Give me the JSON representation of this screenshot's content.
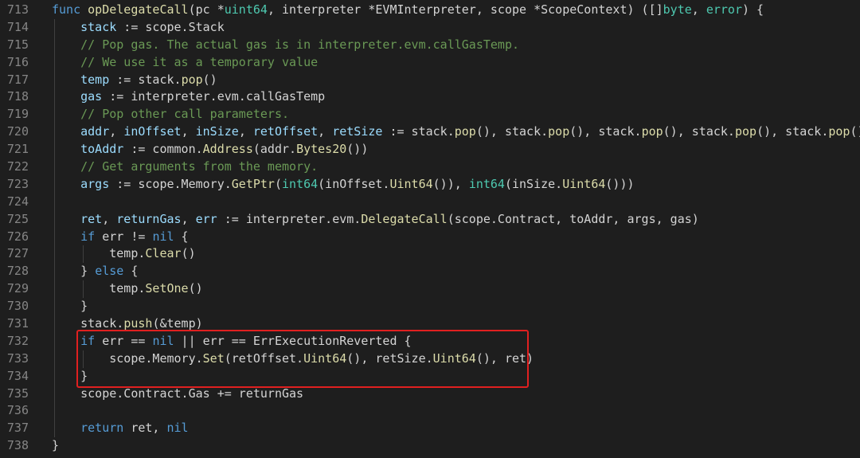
{
  "editor": {
    "lines": [
      {
        "n": "713",
        "indent": 0,
        "tokens": [
          [
            "kw",
            "func "
          ],
          [
            "fn",
            "opDelegateCall"
          ],
          [
            "pl",
            "(pc *"
          ],
          [
            "ty",
            "uint64"
          ],
          [
            "pl",
            ", interpreter *EVMInterpreter, scope *ScopeContext) ([]"
          ],
          [
            "ty",
            "byte"
          ],
          [
            "pl",
            ", "
          ],
          [
            "ty",
            "error"
          ],
          [
            "pl",
            ") {"
          ]
        ]
      },
      {
        "n": "714",
        "indent": 1,
        "tokens": [
          [
            "vr",
            "stack"
          ],
          [
            "pl",
            " := scope.Stack"
          ]
        ]
      },
      {
        "n": "715",
        "indent": 1,
        "tokens": [
          [
            "cm",
            "// Pop gas. The actual gas is in interpreter.evm.callGasTemp."
          ]
        ]
      },
      {
        "n": "716",
        "indent": 1,
        "tokens": [
          [
            "cm",
            "// We use it as a temporary value"
          ]
        ]
      },
      {
        "n": "717",
        "indent": 1,
        "tokens": [
          [
            "vr",
            "temp"
          ],
          [
            "pl",
            " := stack."
          ],
          [
            "fn",
            "pop"
          ],
          [
            "pl",
            "()"
          ]
        ]
      },
      {
        "n": "718",
        "indent": 1,
        "tokens": [
          [
            "vr",
            "gas"
          ],
          [
            "pl",
            " := interpreter.evm.callGasTemp"
          ]
        ]
      },
      {
        "n": "719",
        "indent": 1,
        "tokens": [
          [
            "cm",
            "// Pop other call parameters."
          ]
        ]
      },
      {
        "n": "720",
        "indent": 1,
        "tokens": [
          [
            "vr",
            "addr"
          ],
          [
            "pl",
            ", "
          ],
          [
            "vr",
            "inOffset"
          ],
          [
            "pl",
            ", "
          ],
          [
            "vr",
            "inSize"
          ],
          [
            "pl",
            ", "
          ],
          [
            "vr",
            "retOffset"
          ],
          [
            "pl",
            ", "
          ],
          [
            "vr",
            "retSize"
          ],
          [
            "pl",
            " := stack."
          ],
          [
            "fn",
            "pop"
          ],
          [
            "pl",
            "(), stack."
          ],
          [
            "fn",
            "pop"
          ],
          [
            "pl",
            "(), stack."
          ],
          [
            "fn",
            "pop"
          ],
          [
            "pl",
            "(), stack."
          ],
          [
            "fn",
            "pop"
          ],
          [
            "pl",
            "(), stack."
          ],
          [
            "fn",
            "pop"
          ],
          [
            "pl",
            "()"
          ]
        ]
      },
      {
        "n": "721",
        "indent": 1,
        "tokens": [
          [
            "vr",
            "toAddr"
          ],
          [
            "pl",
            " := common."
          ],
          [
            "fn",
            "Address"
          ],
          [
            "pl",
            "(addr."
          ],
          [
            "fn",
            "Bytes20"
          ],
          [
            "pl",
            "())"
          ]
        ]
      },
      {
        "n": "722",
        "indent": 1,
        "tokens": [
          [
            "cm",
            "// Get arguments from the memory."
          ]
        ]
      },
      {
        "n": "723",
        "indent": 1,
        "tokens": [
          [
            "vr",
            "args"
          ],
          [
            "pl",
            " := scope.Memory."
          ],
          [
            "fn",
            "GetPtr"
          ],
          [
            "pl",
            "("
          ],
          [
            "ty",
            "int64"
          ],
          [
            "pl",
            "(inOffset."
          ],
          [
            "fn",
            "Uint64"
          ],
          [
            "pl",
            "()), "
          ],
          [
            "ty",
            "int64"
          ],
          [
            "pl",
            "(inSize."
          ],
          [
            "fn",
            "Uint64"
          ],
          [
            "pl",
            "()))"
          ]
        ]
      },
      {
        "n": "724",
        "indent": 1,
        "tokens": []
      },
      {
        "n": "725",
        "indent": 1,
        "tokens": [
          [
            "vr",
            "ret"
          ],
          [
            "pl",
            ", "
          ],
          [
            "vr",
            "returnGas"
          ],
          [
            "pl",
            ", "
          ],
          [
            "vr",
            "err"
          ],
          [
            "pl",
            " := interpreter.evm."
          ],
          [
            "fn",
            "DelegateCall"
          ],
          [
            "pl",
            "(scope.Contract, toAddr, args, gas)"
          ]
        ]
      },
      {
        "n": "726",
        "indent": 1,
        "tokens": [
          [
            "kw",
            "if"
          ],
          [
            "pl",
            " err != "
          ],
          [
            "kw",
            "nil"
          ],
          [
            "pl",
            " {"
          ]
        ]
      },
      {
        "n": "727",
        "indent": 2,
        "tokens": [
          [
            "pl",
            "temp."
          ],
          [
            "fn",
            "Clear"
          ],
          [
            "pl",
            "()"
          ]
        ]
      },
      {
        "n": "728",
        "indent": 1,
        "tokens": [
          [
            "pl",
            "} "
          ],
          [
            "kw",
            "else"
          ],
          [
            "pl",
            " {"
          ]
        ]
      },
      {
        "n": "729",
        "indent": 2,
        "tokens": [
          [
            "pl",
            "temp."
          ],
          [
            "fn",
            "SetOne"
          ],
          [
            "pl",
            "()"
          ]
        ]
      },
      {
        "n": "730",
        "indent": 1,
        "tokens": [
          [
            "pl",
            "}"
          ]
        ]
      },
      {
        "n": "731",
        "indent": 1,
        "tokens": [
          [
            "pl",
            "stack."
          ],
          [
            "fn",
            "push"
          ],
          [
            "pl",
            "(&temp)"
          ]
        ]
      },
      {
        "n": "732",
        "indent": 1,
        "tokens": [
          [
            "kw",
            "if"
          ],
          [
            "pl",
            " err == "
          ],
          [
            "kw",
            "nil"
          ],
          [
            "pl",
            " || err == ErrExecutionReverted {"
          ]
        ]
      },
      {
        "n": "733",
        "indent": 2,
        "tokens": [
          [
            "pl",
            "scope.Memory."
          ],
          [
            "fn",
            "Set"
          ],
          [
            "pl",
            "(retOffset."
          ],
          [
            "fn",
            "Uint64"
          ],
          [
            "pl",
            "(), retSize."
          ],
          [
            "fn",
            "Uint64"
          ],
          [
            "pl",
            "(), ret)"
          ]
        ]
      },
      {
        "n": "734",
        "indent": 1,
        "tokens": [
          [
            "pl",
            "}"
          ]
        ]
      },
      {
        "n": "735",
        "indent": 1,
        "tokens": [
          [
            "pl",
            "scope.Contract.Gas += returnGas"
          ]
        ]
      },
      {
        "n": "736",
        "indent": 1,
        "tokens": []
      },
      {
        "n": "737",
        "indent": 1,
        "tokens": [
          [
            "kw",
            "return"
          ],
          [
            "pl",
            " ret, "
          ],
          [
            "kw",
            "nil"
          ]
        ]
      },
      {
        "n": "738",
        "indent": 0,
        "tokens": [
          [
            "pl",
            "}"
          ]
        ]
      }
    ]
  },
  "colors": {
    "background": "#1e1e1e",
    "highlight_border": "#e02020"
  }
}
